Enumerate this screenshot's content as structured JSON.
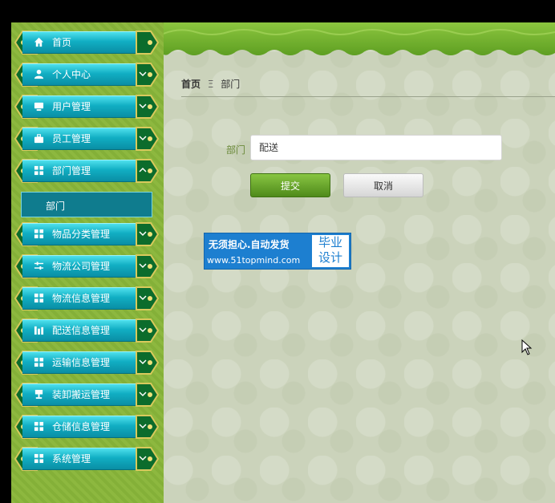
{
  "sidebar": {
    "items": [
      {
        "label": "首页",
        "icon": "home-icon",
        "has_chevron": false
      },
      {
        "label": "个人中心",
        "icon": "user-icon",
        "has_chevron": true,
        "chevron": "down"
      },
      {
        "label": "用户管理",
        "icon": "monitor-icon",
        "has_chevron": true,
        "chevron": "down"
      },
      {
        "label": "员工管理",
        "icon": "briefcase-icon",
        "has_chevron": true,
        "chevron": "down"
      },
      {
        "label": "部门管理",
        "icon": "grid-icon",
        "has_chevron": true,
        "chevron": "up"
      },
      {
        "label": "物品分类管理",
        "icon": "grid-icon",
        "has_chevron": true,
        "chevron": "down"
      },
      {
        "label": "物流公司管理",
        "icon": "sliders-icon",
        "has_chevron": true,
        "chevron": "down"
      },
      {
        "label": "物流信息管理",
        "icon": "grid-icon",
        "has_chevron": true,
        "chevron": "down"
      },
      {
        "label": "配送信息管理",
        "icon": "chart-icon",
        "has_chevron": true,
        "chevron": "down"
      },
      {
        "label": "运输信息管理",
        "icon": "grid-icon",
        "has_chevron": true,
        "chevron": "down"
      },
      {
        "label": "装卸搬运管理",
        "icon": "stamp-icon",
        "has_chevron": true,
        "chevron": "down"
      },
      {
        "label": "仓储信息管理",
        "icon": "grid-icon",
        "has_chevron": true,
        "chevron": "down"
      },
      {
        "label": "系统管理",
        "icon": "grid-icon",
        "has_chevron": true,
        "chevron": "down"
      }
    ],
    "submenu": {
      "label": "部门"
    }
  },
  "breadcrumb": {
    "home": "首页",
    "separator": "Ξ",
    "current": "部门"
  },
  "form": {
    "field_label": "部门",
    "field_value": "配送",
    "submit_label": "提交",
    "cancel_label": "取消"
  },
  "watermark": {
    "line1": "无须担心.自动发货",
    "line2": "www.51topmind.com",
    "box_line1": "毕业",
    "box_line2": "设计"
  },
  "colors": {
    "sidebar_bg": "#8db83f",
    "menu_teal": "#11aec3",
    "banner_green": "#6aa82a",
    "submit_green": "#5f9a24",
    "label_green": "#6b8a3a"
  }
}
